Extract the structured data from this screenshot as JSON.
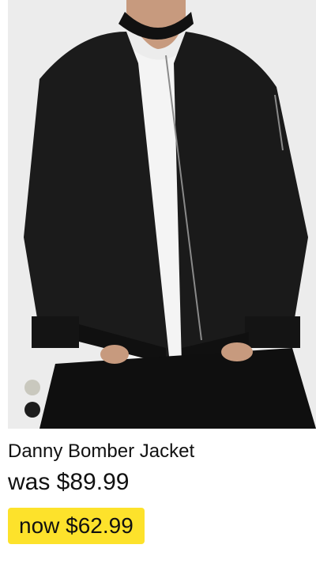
{
  "product": {
    "name": "Danny Bomber Jacket",
    "was_price": "was $89.99",
    "now_price": "now $62.99",
    "image_icon": "product-photo",
    "highlight_color": "#fde22b",
    "swatches": [
      {
        "name": "stone",
        "color": "#c9c8be"
      },
      {
        "name": "black",
        "color": "#1d1d1d"
      }
    ]
  }
}
